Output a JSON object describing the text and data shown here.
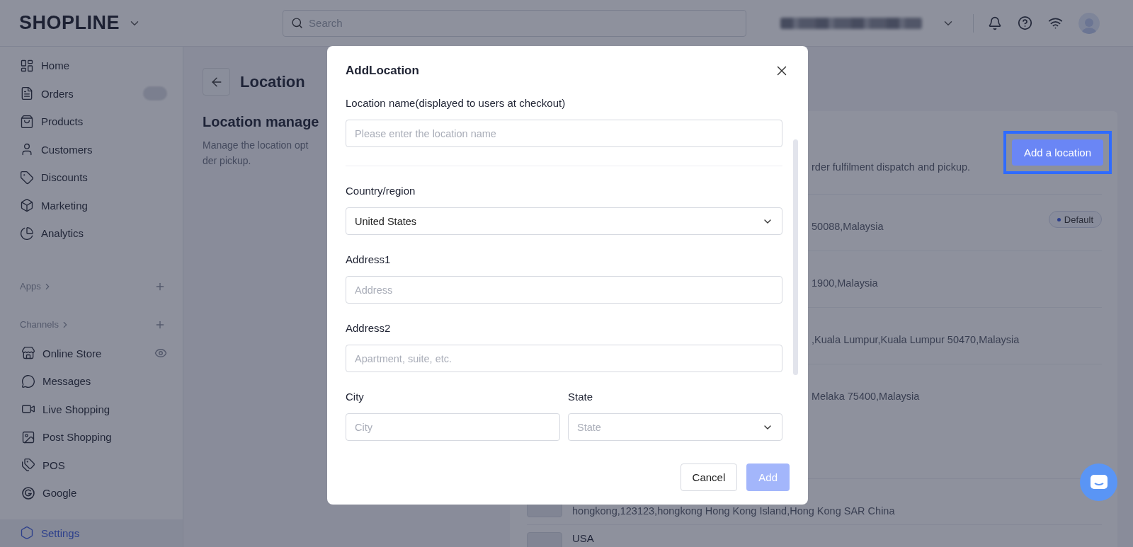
{
  "header": {
    "logo": "SHOPLINE",
    "search": {
      "placeholder": "Search"
    }
  },
  "sidebar": {
    "items": [
      {
        "label": "Home",
        "selected": false
      },
      {
        "label": "Orders",
        "selected": false
      },
      {
        "label": "Products",
        "selected": false
      },
      {
        "label": "Customers",
        "selected": false
      },
      {
        "label": "Discounts",
        "selected": false
      },
      {
        "label": "Marketing",
        "selected": false
      },
      {
        "label": "Analytics",
        "selected": false
      }
    ],
    "apps": {
      "label": "Apps"
    },
    "channels": {
      "label": "Channels",
      "items": [
        {
          "label": "Online Store",
          "selected": false
        },
        {
          "label": "Messages",
          "selected": false
        },
        {
          "label": "Live Shopping",
          "selected": false
        },
        {
          "label": "Post Shopping",
          "selected": false
        },
        {
          "label": "POS",
          "selected": false
        },
        {
          "label": "Google",
          "selected": false
        }
      ]
    },
    "footer_items": [
      {
        "label": "Settings",
        "selected": true
      }
    ]
  },
  "page": {
    "title": "Location",
    "section": {
      "title": "Location manage",
      "description_lines": [
        "Manage the location opt",
        "der pickup."
      ]
    },
    "card": {
      "description": "rder fulfilment dispatch and pickup.",
      "button": {
        "label": "Add a location",
        "highlighted": true
      },
      "locations": [
        {
          "address": "50088,Malaysia",
          "badge": "Default"
        },
        {
          "address": "1900,Malaysia"
        },
        {
          "address": ",Kuala Lumpur,Kuala Lumpur 50470,Malaysia"
        },
        {
          "address": "Melaka 75400,Malaysia"
        },
        {
          "address": "hongkong,123123,hongkong Hong Kong Island,Hong Kong SAR China"
        },
        {
          "name": "USA"
        }
      ]
    }
  },
  "modal": {
    "title": "AddLocation",
    "sections": [
      {
        "rows": [
          [
            {
              "kind": "input",
              "label": "Location name(displayed to users at checkout)",
              "placeholder": "Please enter the location name"
            }
          ]
        ]
      },
      {
        "rows": [
          [
            {
              "kind": "select",
              "label": "Country/region",
              "value": "United States"
            }
          ],
          [
            {
              "kind": "input",
              "label": "Address1",
              "placeholder": "Address"
            }
          ],
          [
            {
              "kind": "input",
              "label": "Address2",
              "placeholder": "Apartment, suite, etc."
            }
          ],
          [
            {
              "kind": "input",
              "label": "City",
              "placeholder": "City"
            },
            {
              "kind": "select",
              "label": "State",
              "placeholder": "State"
            }
          ]
        ]
      }
    ],
    "buttons": [
      {
        "label": "Cancel",
        "disabled": false
      },
      {
        "label": "Add",
        "disabled": true
      }
    ]
  }
}
